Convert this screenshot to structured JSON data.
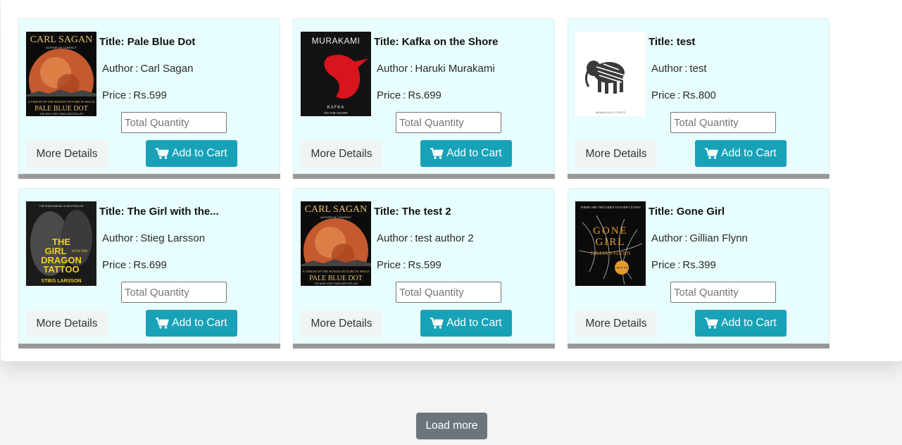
{
  "labels": {
    "title_prefix": "Title:",
    "author_prefix": "Author",
    "price_prefix": "Price",
    "separator": ":",
    "quantity_placeholder": "Total Quantity",
    "more_details": "More Details",
    "add_to_cart": "Add to Cart",
    "load_more": "Load more"
  },
  "colors": {
    "card_bg": "#e8fdfd",
    "card_bar": "#999999",
    "cart_button": "#17a2b8",
    "load_more_button": "#6c757d"
  },
  "books": [
    {
      "title": "Pale Blue Dot",
      "author": "Carl Sagan",
      "price": "Rs.599",
      "cover": {
        "style": "sagan",
        "top_text": "CARL SAGAN",
        "sub_text": "AUTHOR OF CONTACT",
        "lower_text": "A VISION OF THE HUMAN FUTURE IN SPACE",
        "bottom_text": "PALE BLUE DOT",
        "footer_text": "THE NEW YORK TIMES BESTSELLER"
      }
    },
    {
      "title": "Kafka on the Shore",
      "author": "Haruki Murakami",
      "price": "Rs.699",
      "cover": {
        "style": "kafka",
        "top_text": "MURAKAMI",
        "bottom_text": "KAFKA",
        "sub_text": "ON THE SHORE"
      }
    },
    {
      "title": "test",
      "author": "test",
      "price": "Rs.800",
      "cover": {
        "style": "elephant",
        "bottom_text": "MAMMALIAN STORIES"
      }
    },
    {
      "title": "The Girl with the...",
      "author": "Stieg Larsson",
      "price": "Rs.699",
      "cover": {
        "style": "dragon",
        "top_text": "THE PHENOMENAL #1 BESTSELLER",
        "title_lines": [
          "THE",
          "GIRL",
          "DRAGON",
          "TATTOO"
        ],
        "small_text": "WITH THE",
        "bottom_text": "STIEG LARSSON"
      }
    },
    {
      "title": "The test 2",
      "author": "test author 2",
      "price": "Rs.599",
      "cover": {
        "style": "sagan",
        "top_text": "CARL SAGAN",
        "sub_text": "AUTHOR OF CONTACT",
        "lower_text": "A VISION OF THE HUMAN FUTURE IN SPACE",
        "bottom_text": "PALE BLUE DOT",
        "footer_text": "THE NEW YORK TIMES BESTSELLER"
      }
    },
    {
      "title": "Gone Girl",
      "author": "Gillian Flynn",
      "price": "Rs.399",
      "cover": {
        "style": "gonegirl",
        "top_text": "THERE ARE TWO SIDES TO EVERY STORY",
        "title_lines": [
          "GONE",
          "GIRL"
        ],
        "bottom_text": "GILLIAN FLYNN",
        "badge_text": "THRILLER OF THE YEAR"
      }
    }
  ]
}
